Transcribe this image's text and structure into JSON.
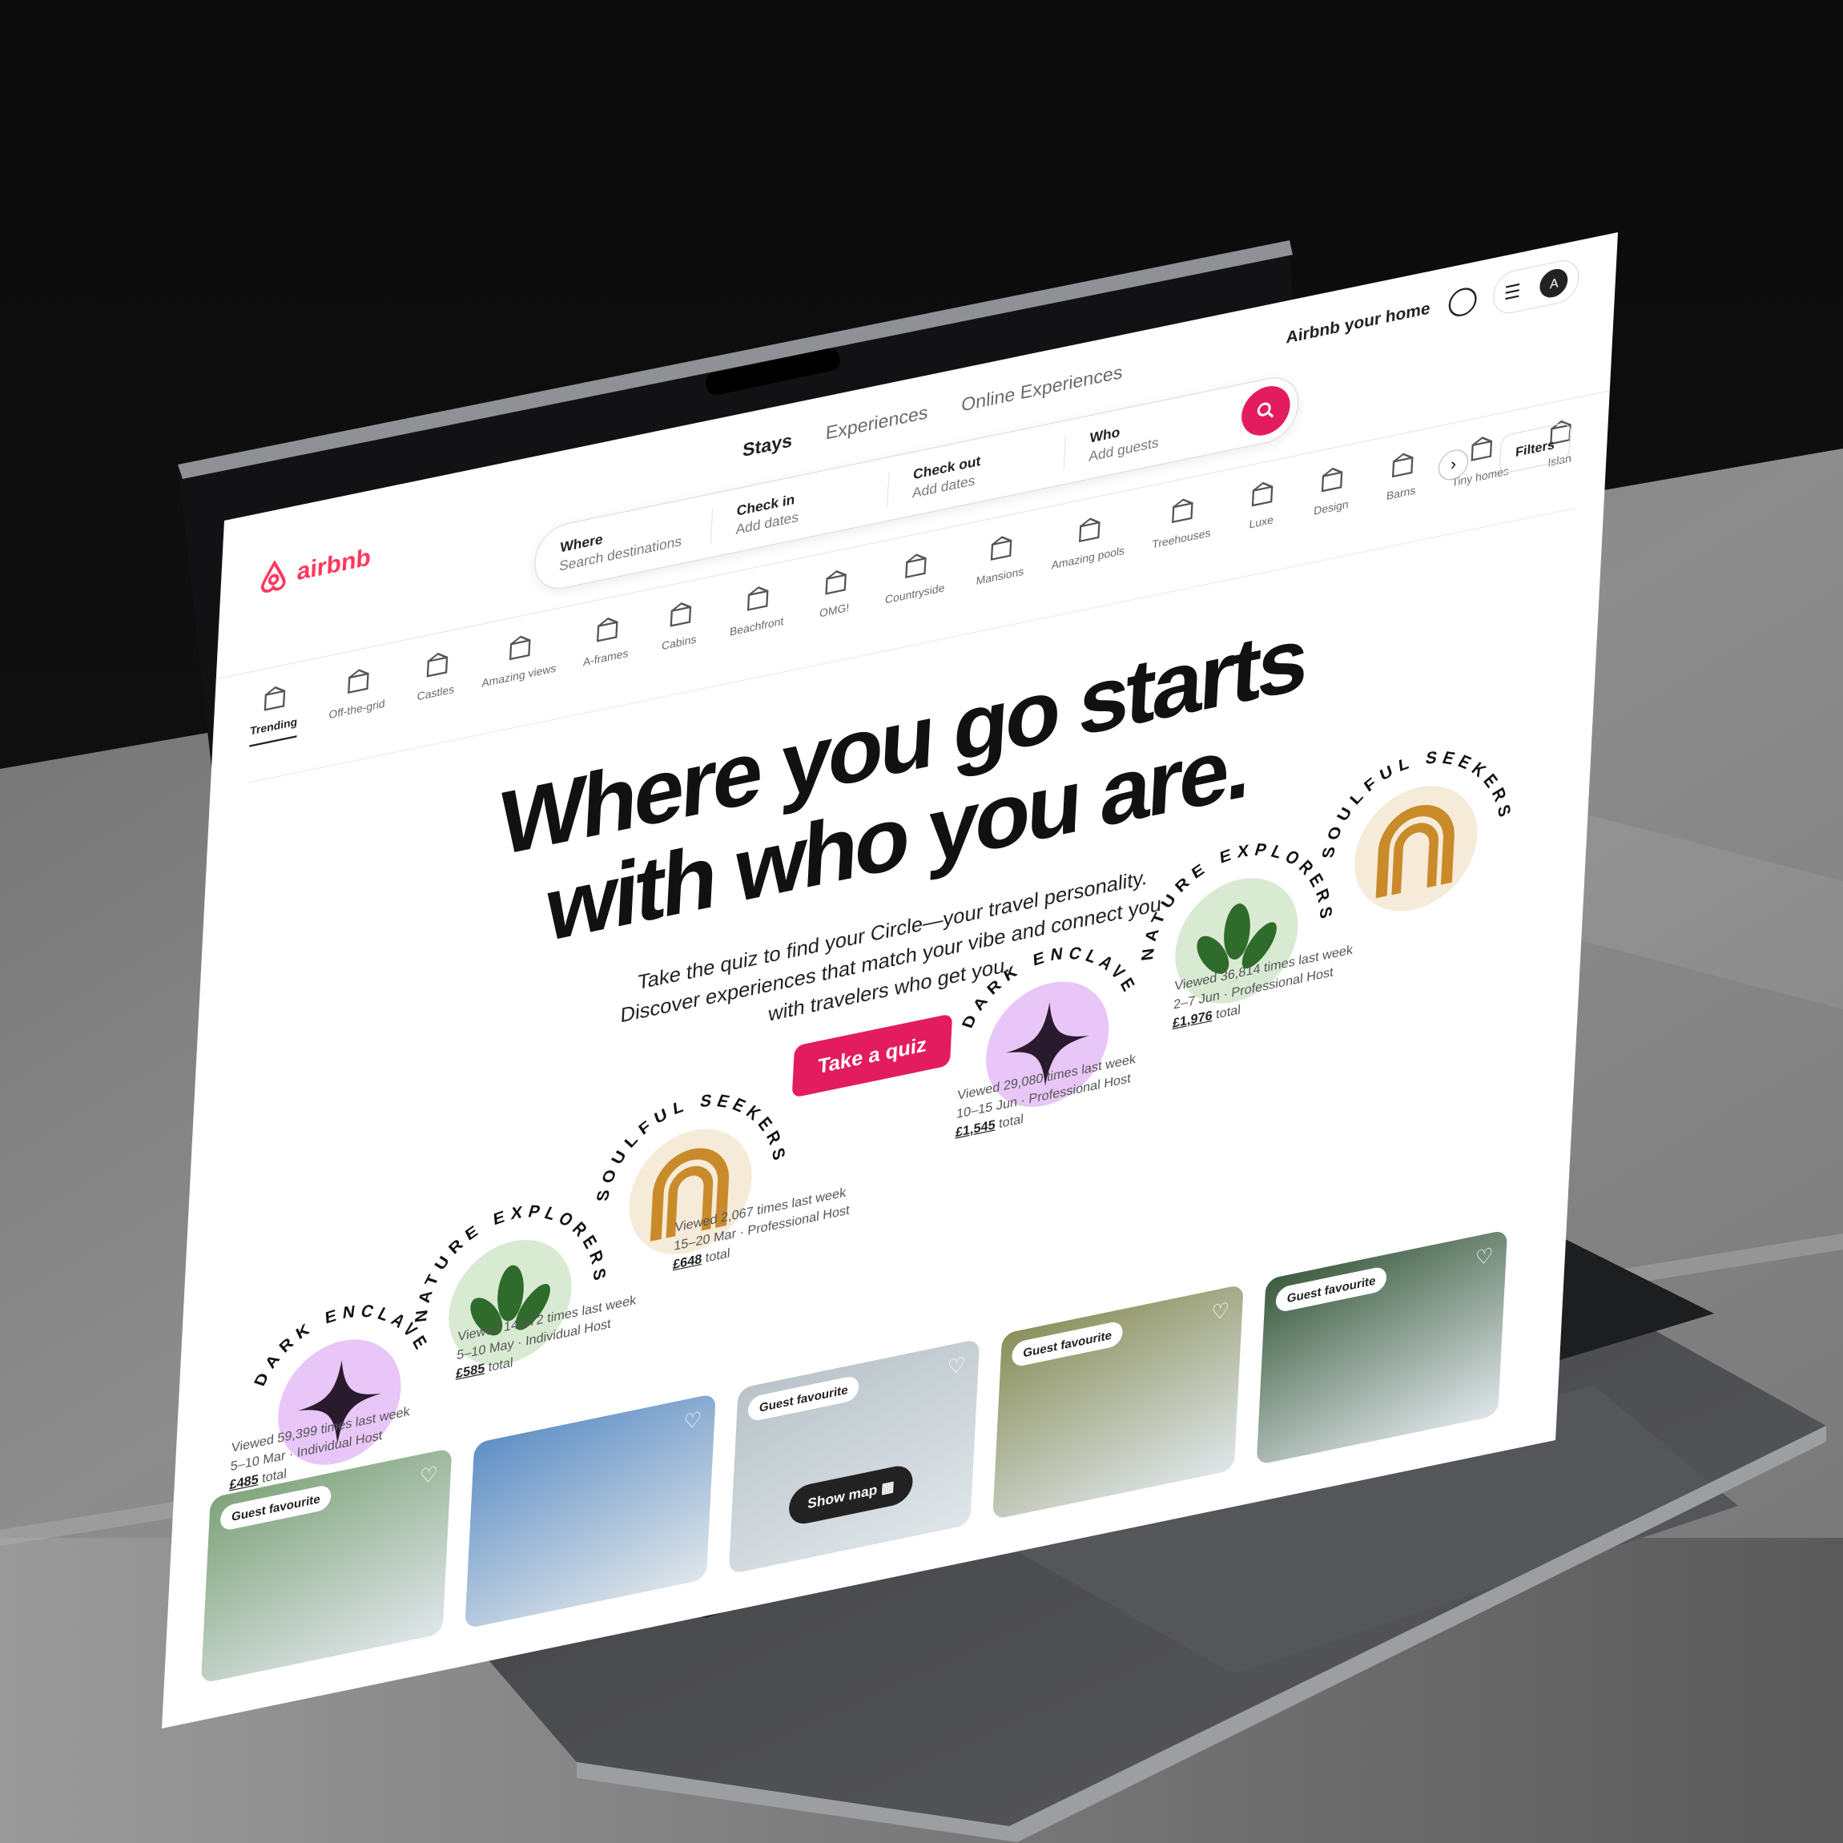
{
  "header": {
    "brand": "airbnb",
    "tabs": [
      "Stays",
      "Experiences",
      "Online Experiences"
    ],
    "host_link": "Airbnb your home",
    "avatar_initial": "A"
  },
  "search": {
    "where_label": "Where",
    "where_placeholder": "Search destinations",
    "checkin_label": "Check in",
    "checkin_placeholder": "Add dates",
    "checkout_label": "Check out",
    "checkout_placeholder": "Add dates",
    "who_label": "Who",
    "who_placeholder": "Add guests"
  },
  "categories": [
    {
      "label": "Trending",
      "icon": "fire-icon",
      "active": true
    },
    {
      "label": "Off-the-grid",
      "icon": "grid-icon",
      "active": false
    },
    {
      "label": "Castles",
      "icon": "castle-icon",
      "active": false
    },
    {
      "label": "Amazing views",
      "icon": "view-icon",
      "active": false
    },
    {
      "label": "A-frames",
      "icon": "aframe-icon",
      "active": false
    },
    {
      "label": "Cabins",
      "icon": "cabin-icon",
      "active": false
    },
    {
      "label": "Beachfront",
      "icon": "beach-icon",
      "active": false
    },
    {
      "label": "OMG!",
      "icon": "ufo-icon",
      "active": false
    },
    {
      "label": "Countryside",
      "icon": "countryside-icon",
      "active": false
    },
    {
      "label": "Mansions",
      "icon": "mansion-icon",
      "active": false
    },
    {
      "label": "Amazing pools",
      "icon": "pool-icon",
      "active": false
    },
    {
      "label": "Treehouses",
      "icon": "treehouse-icon",
      "active": false
    },
    {
      "label": "Luxe",
      "icon": "luxe-icon",
      "active": false
    },
    {
      "label": "Design",
      "icon": "design-icon",
      "active": false
    },
    {
      "label": "Barns",
      "icon": "barn-icon",
      "active": false
    },
    {
      "label": "Tiny homes",
      "icon": "tiny-home-icon",
      "active": false
    },
    {
      "label": "Islan",
      "icon": "island-icon",
      "active": false
    }
  ],
  "filters_label": "Filters",
  "hero": {
    "title_line1": "Where you go starts",
    "title_line2": "with who you are.",
    "subtitle_line1": "Take the quiz to find your Circle—your travel personality.",
    "subtitle_line2": "Discover experiences that match your vibe and connect you",
    "subtitle_line3": "with travelers who get you.",
    "cta": "Take a quiz"
  },
  "badges": [
    {
      "name": "DARK ENCLAVE",
      "color": "#e8c6f7",
      "icon": "star-icon"
    },
    {
      "name": "NATURE EXPLORERS",
      "color": "#d9ead3",
      "icon": "leaf-icon"
    },
    {
      "name": "SOULFUL SEEKERS",
      "color": "#f6ebd9",
      "icon": "arch-icon"
    },
    {
      "name": "DARK ENCLAVE",
      "color": "#e8c6f7",
      "icon": "star-icon"
    },
    {
      "name": "NATURE EXPLORERS",
      "color": "#d9ead3",
      "icon": "leaf-icon"
    },
    {
      "name": "SOULFUL SEEKERS",
      "color": "#f6ebd9",
      "icon": "arch-icon"
    }
  ],
  "listings": [
    {
      "views": "Viewed 59,399 times last week",
      "dates": "5–10 Mar · Individual Host",
      "price": "£485",
      "price_suffix": "total",
      "badge": "Guest favourite"
    },
    {
      "views": "Viewed 14,672 times last week",
      "dates": "5–10 May · Individual Host",
      "price": "£585",
      "price_suffix": "total",
      "badge": ""
    },
    {
      "views": "Viewed 2,067 times last week",
      "dates": "15–20 Mar · Professional Host",
      "price": "£648",
      "price_suffix": "total",
      "badge": "Guest favourite"
    },
    {
      "views": "Viewed 29,080 times last week",
      "dates": "10–15 Jun · Professional Host",
      "price": "£1,545",
      "price_suffix": "total",
      "badge": "Guest favourite"
    },
    {
      "views": "Viewed 36,814 times last week",
      "dates": "2–7 Jun · Professional Host",
      "price": "£1,976",
      "price_suffix": "total",
      "badge": "Guest favourite"
    }
  ],
  "show_map": "Show map",
  "colors": {
    "brand": "#ff385c",
    "accent": "#e31c5f"
  }
}
